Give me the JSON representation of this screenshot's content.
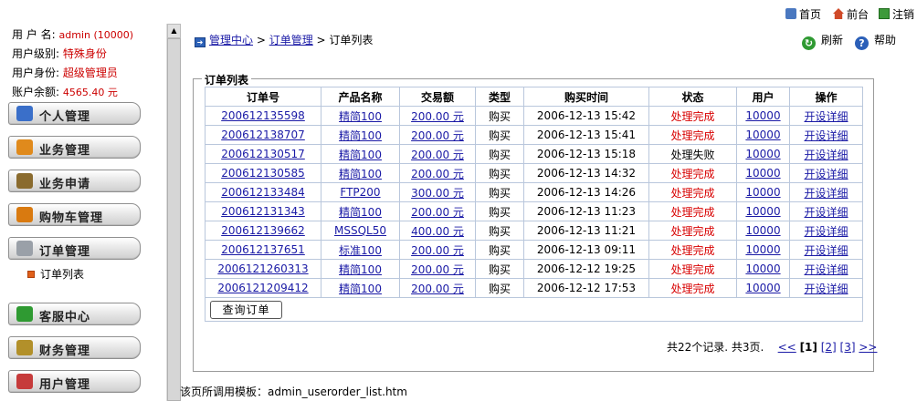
{
  "user": {
    "name_label": "用 户 名:",
    "name_value": "admin (10000)",
    "level_label": "用户级别:",
    "level_value": "特殊身份",
    "identity_label": "用户身份:",
    "identity_value": "超级管理员",
    "balance_label": "账户余额:",
    "balance_value": "4565.40 元"
  },
  "sidebar": {
    "menu": [
      {
        "label": "个人管理",
        "icon": "person-icon",
        "color": "#3a6fc9"
      },
      {
        "label": "业务管理",
        "icon": "blocks-icon",
        "color": "#e08a1c"
      },
      {
        "label": "业务申请",
        "icon": "pen-icon",
        "color": "#8a6b2e"
      },
      {
        "label": "购物车管理",
        "icon": "cart-icon",
        "color": "#d97a10"
      },
      {
        "label": "订单管理",
        "icon": "notepad-icon",
        "color": "#9aa0a8"
      },
      {
        "label": "客服中心",
        "icon": "check-icon",
        "color": "#2f9a32"
      },
      {
        "label": "财务管理",
        "icon": "money-icon",
        "color": "#b2902a"
      },
      {
        "label": "用户管理",
        "icon": "users-icon",
        "color": "#c63b3b"
      }
    ],
    "sub_item": "订单列表"
  },
  "top_links": {
    "home": "首页",
    "front": "前台",
    "logout": "注销"
  },
  "breadcrumb": {
    "root": "管理中心",
    "sep1": " > ",
    "parent": "订单管理",
    "sep2": " > ",
    "current": "订单列表"
  },
  "actions": {
    "refresh": "刷新",
    "help": "帮助"
  },
  "legend": "订单列表",
  "table": {
    "headers": [
      "订单号",
      "产品名称",
      "交易额",
      "类型",
      "购买时间",
      "状态",
      "用户",
      "操作"
    ],
    "rows": [
      {
        "order_no": "200612135598",
        "product": "精简100",
        "amount": "200.00 元",
        "type": "购买",
        "time": "2006-12-13 15:42",
        "status": "处理完成",
        "user": "10000",
        "op": "开设详细"
      },
      {
        "order_no": "200612138707",
        "product": "精简100",
        "amount": "200.00 元",
        "type": "购买",
        "time": "2006-12-13 15:41",
        "status": "处理完成",
        "user": "10000",
        "op": "开设详细"
      },
      {
        "order_no": "200612130517",
        "product": "精简100",
        "amount": "200.00 元",
        "type": "购买",
        "time": "2006-12-13 15:18",
        "status": "处理失败",
        "user": "10000",
        "op": "开设详细"
      },
      {
        "order_no": "200612130585",
        "product": "精简100",
        "amount": "200.00 元",
        "type": "购买",
        "time": "2006-12-13 14:32",
        "status": "处理完成",
        "user": "10000",
        "op": "开设详细"
      },
      {
        "order_no": "200612133484",
        "product": "FTP200",
        "amount": "300.00 元",
        "type": "购买",
        "time": "2006-12-13 14:26",
        "status": "处理完成",
        "user": "10000",
        "op": "开设详细"
      },
      {
        "order_no": "200612131343",
        "product": "精简100",
        "amount": "200.00 元",
        "type": "购买",
        "time": "2006-12-13 11:23",
        "status": "处理完成",
        "user": "10000",
        "op": "开设详细"
      },
      {
        "order_no": "200612139662",
        "product": "MSSQL50",
        "amount": "400.00 元",
        "type": "购买",
        "time": "2006-12-13 11:21",
        "status": "处理完成",
        "user": "10000",
        "op": "开设详细"
      },
      {
        "order_no": "200612137651",
        "product": "标准100",
        "amount": "200.00 元",
        "type": "购买",
        "time": "2006-12-13 09:11",
        "status": "处理完成",
        "user": "10000",
        "op": "开设详细"
      },
      {
        "order_no": "2006121260313",
        "product": "精简100",
        "amount": "200.00 元",
        "type": "购买",
        "time": "2006-12-12 19:25",
        "status": "处理完成",
        "user": "10000",
        "op": "开设详细"
      },
      {
        "order_no": "2006121209412",
        "product": "精简100",
        "amount": "200.00 元",
        "type": "购买",
        "time": "2006-12-12 17:53",
        "status": "处理完成",
        "user": "10000",
        "op": "开设详细"
      }
    ],
    "query_button": "查询订单"
  },
  "pager": {
    "summary": "共22个记录. 共3页.",
    "prev": "<<",
    "page1": "[1]",
    "page2": "[2]",
    "page3": "[3]",
    "next": ">>"
  },
  "footer_note": "该页所调用模板：admin_userorder_list.htm",
  "colors": {
    "link": "#1a1aa6",
    "status_done": "#d80000",
    "user_value": "#cc0000"
  }
}
